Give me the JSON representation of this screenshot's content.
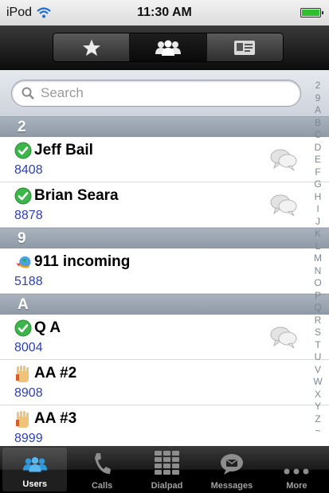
{
  "status_bar": {
    "carrier": "iPod",
    "time": "11:30 AM"
  },
  "segments": [
    {
      "icon": "star-icon",
      "selected": false
    },
    {
      "icon": "users-icon",
      "selected": true
    },
    {
      "icon": "contact-card-icon",
      "selected": false
    }
  ],
  "search": {
    "placeholder": "Search"
  },
  "index_letters": [
    "2",
    "9",
    "A",
    "B",
    "C",
    "D",
    "E",
    "F",
    "G",
    "H",
    "I",
    "J",
    "K",
    "L",
    "M",
    "N",
    "O",
    "P",
    "Q",
    "R",
    "S",
    "T",
    "U",
    "V",
    "W",
    "X",
    "Y",
    "Z",
    "~"
  ],
  "sections": [
    {
      "header": "2",
      "contacts": [
        {
          "name": "Jeff Bail",
          "number": "8408",
          "status": "available",
          "chat": true
        },
        {
          "name": "Brian Seara",
          "number": "8878",
          "status": "available",
          "chat": true
        }
      ]
    },
    {
      "header": "9",
      "contacts": [
        {
          "name": "911 incoming",
          "number": "5188",
          "status": "phone",
          "chat": false
        }
      ]
    },
    {
      "header": "A",
      "contacts": [
        {
          "name": "Q A",
          "number": "8004",
          "status": "available",
          "chat": true
        },
        {
          "name": "AA #2",
          "number": "8908",
          "status": "hand",
          "chat": false
        },
        {
          "name": "AA #3",
          "number": "8999",
          "status": "hand",
          "chat": false
        }
      ]
    }
  ],
  "tabs": [
    {
      "label": "Users",
      "icon": "users-icon",
      "selected": true
    },
    {
      "label": "Calls",
      "icon": "phone-icon",
      "selected": false
    },
    {
      "label": "Dialpad",
      "icon": "dialpad-icon",
      "selected": false
    },
    {
      "label": "Messages",
      "icon": "message-icon",
      "selected": false
    },
    {
      "label": "More",
      "icon": "more-icon",
      "selected": false
    }
  ],
  "colors": {
    "number_link": "#2c3fb6",
    "status_available": "#3cb64a",
    "section_header": "#98a3af"
  }
}
